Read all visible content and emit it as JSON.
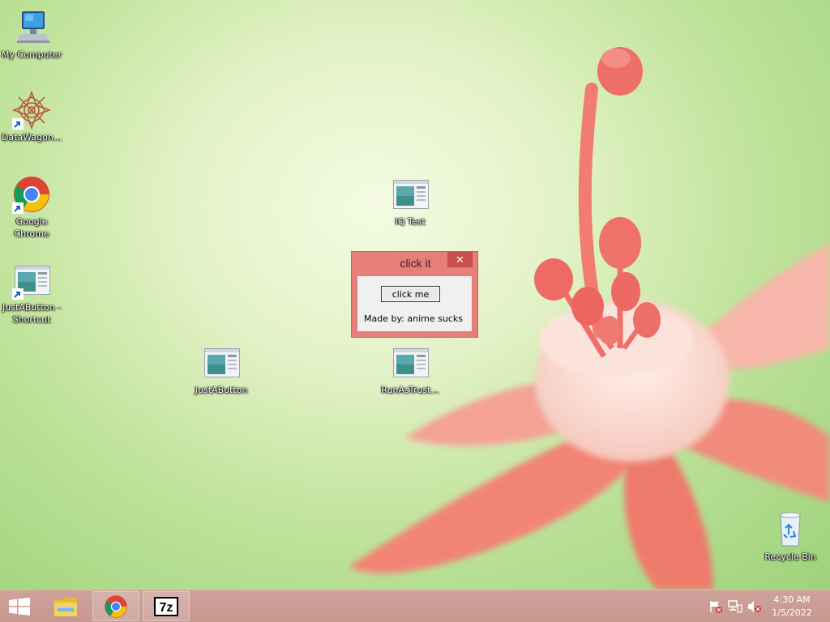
{
  "desktop": {
    "icons": [
      {
        "label": "My Computer"
      },
      {
        "label": "DataWagon..."
      },
      {
        "label": "Google Chrome"
      },
      {
        "label": "JustAButton - Shortcut"
      },
      {
        "label": "IQ Test"
      },
      {
        "label": "JustAButton"
      },
      {
        "label": "RunAsTrust..."
      },
      {
        "label": "Recycle Bin"
      }
    ]
  },
  "dialog": {
    "title": "click it",
    "close_glyph": "✕",
    "button_label": "click me",
    "footer_text": "Made by: anime sucks",
    "colors": {
      "frame": "#e57f78",
      "close": "#c7504a"
    }
  },
  "taskbar": {
    "items": [
      {
        "icon": "windows-logo-icon"
      },
      {
        "icon": "file-explorer-icon"
      },
      {
        "icon": "chrome-icon"
      },
      {
        "icon": "7zip-icon",
        "text": "7z"
      }
    ],
    "tray": {
      "icons": [
        "action-center-flag-icon",
        "network-icon",
        "volume-muted-icon"
      ]
    },
    "clock": {
      "time": "4:30 AM",
      "date": "1/5/2022"
    },
    "colors": {
      "background": "#c99c94"
    }
  }
}
